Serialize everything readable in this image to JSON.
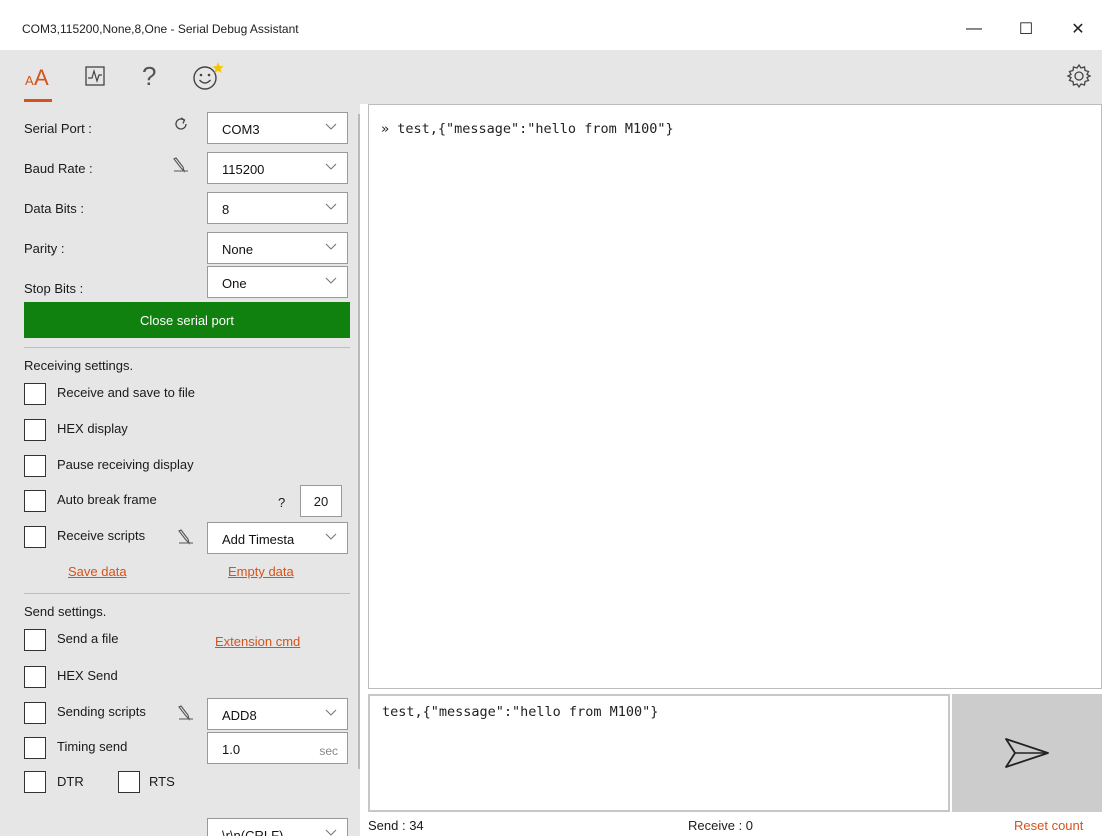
{
  "window": {
    "title": "COM3,115200,None,8,One - Serial Debug Assistant",
    "minimize": "—",
    "maximize": "☐",
    "close": "✕"
  },
  "toolbar": {
    "text_tab": "AA",
    "items": [
      "text-mode-icon",
      "chart-icon",
      "help-icon",
      "smiley-icon",
      "settings-icon"
    ]
  },
  "serial": {
    "port_label": "Serial Port :",
    "port_value": "COM3",
    "baud_label": "Baud Rate :",
    "baud_value": "115200",
    "databits_label": "Data Bits :",
    "databits_value": "8",
    "parity_label": "Parity :",
    "parity_value": "None",
    "stopbits_label": "Stop Bits :",
    "stopbits_value": "One",
    "close_button": "Close serial port"
  },
  "receiving": {
    "title": "Receiving settings.",
    "save_to_file": "Receive and save to file",
    "hex_display": "HEX display",
    "pause_display": "Pause receiving display",
    "auto_break": "Auto break frame",
    "auto_break_help": "?",
    "auto_break_value": "20",
    "scripts": "Receive scripts",
    "scripts_value": "Add Timesta",
    "save_data": "Save data",
    "empty_data": "Empty data"
  },
  "sending": {
    "title": "Send settings.",
    "send_file": "Send a file",
    "extension_cmd": "Extension cmd",
    "hex_send": "HEX Send",
    "scripts": "Sending scripts",
    "scripts_value": "ADD8",
    "timing": "Timing send",
    "timing_value": "1.0",
    "timing_unit": "sec",
    "dtr": "DTR",
    "rts": "RTS",
    "line_break_value": "\\r\\n(CRLF)"
  },
  "receive_panel": {
    "text": "» test,{\"message\":\"hello from M100\"}"
  },
  "send_panel": {
    "text": "test,{\"message\":\"hello from M100\"}"
  },
  "status": {
    "send": "Send : 34",
    "receive": "Receive : 0",
    "reset": "Reset count"
  },
  "colors": {
    "accent": "#d4531b",
    "green": "#10800f",
    "panel": "#e6e6e6"
  }
}
